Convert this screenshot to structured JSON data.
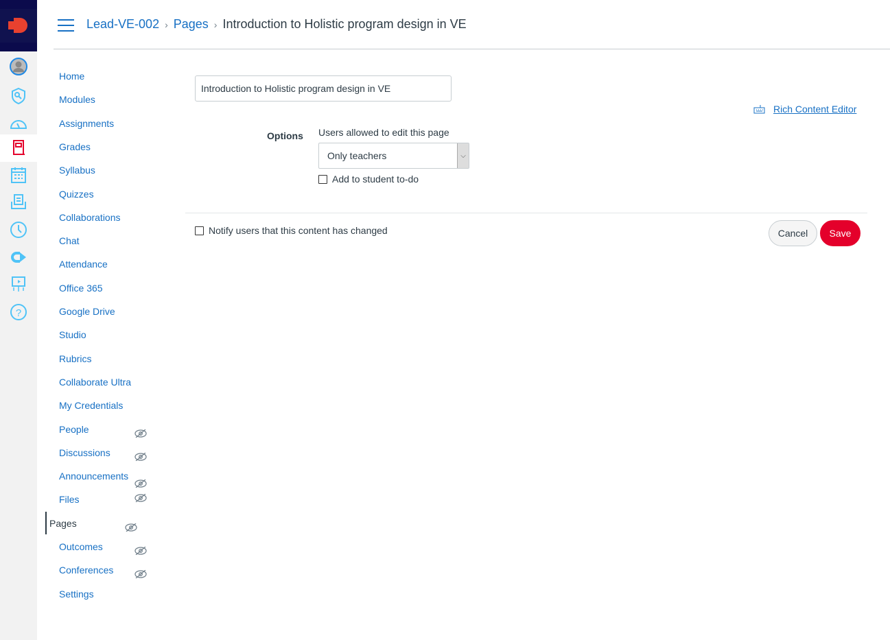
{
  "colors": {
    "brand_dark": "#0b0b4c",
    "logo": "#e8412f",
    "link": "#1770c4",
    "rail_icon": "#4fc3f7",
    "active_icon": "#e4002b",
    "save": "#e4002b"
  },
  "rail": {
    "items": [
      {
        "name": "account-icon"
      },
      {
        "name": "admin-icon"
      },
      {
        "name": "dashboard-icon"
      },
      {
        "name": "courses-icon",
        "active": true
      },
      {
        "name": "calendar-icon"
      },
      {
        "name": "inbox-icon"
      },
      {
        "name": "history-icon"
      },
      {
        "name": "commons-icon"
      },
      {
        "name": "studio-icon"
      },
      {
        "name": "help-icon"
      }
    ]
  },
  "breadcrumb": {
    "course": "Lead-VE-002",
    "section": "Pages",
    "current": "Introduction to Holistic program design in VE"
  },
  "nav": {
    "items": [
      {
        "label": "Home",
        "hidden": false
      },
      {
        "label": "Modules",
        "hidden": false
      },
      {
        "label": "Assignments",
        "hidden": false
      },
      {
        "label": "Grades",
        "hidden": false
      },
      {
        "label": "Syllabus",
        "hidden": false
      },
      {
        "label": "Quizzes",
        "hidden": false
      },
      {
        "label": "Collaborations",
        "hidden": false
      },
      {
        "label": "Chat",
        "hidden": false
      },
      {
        "label": "Attendance",
        "hidden": false
      },
      {
        "label": "Office 365",
        "hidden": false
      },
      {
        "label": "Google Drive",
        "hidden": false
      },
      {
        "label": "Studio",
        "hidden": false
      },
      {
        "label": "Rubrics",
        "hidden": false
      },
      {
        "label": "Collaborate Ultra",
        "hidden": false
      },
      {
        "label": "My Credentials",
        "hidden": false
      },
      {
        "label": "People",
        "hidden": true
      },
      {
        "label": "Discussions",
        "hidden": true
      },
      {
        "label": "Announcements",
        "hidden": true
      },
      {
        "label": "Files",
        "hidden": true
      },
      {
        "label": "Pages",
        "hidden": true,
        "current": true
      },
      {
        "label": "Outcomes",
        "hidden": true
      },
      {
        "label": "Conferences",
        "hidden": true
      },
      {
        "label": "Settings",
        "hidden": false
      }
    ]
  },
  "form": {
    "title_value": "Introduction to Holistic program design in VE",
    "rce_link": "Rich Content Editor",
    "options_label": "Options",
    "edit_label": "Users allowed to edit this page",
    "edit_value": "Only teachers",
    "todo_label": "Add to student to-do",
    "todo_checked": false,
    "notify_label": "Notify users that this content has changed",
    "notify_checked": false,
    "cancel": "Cancel",
    "save": "Save"
  }
}
